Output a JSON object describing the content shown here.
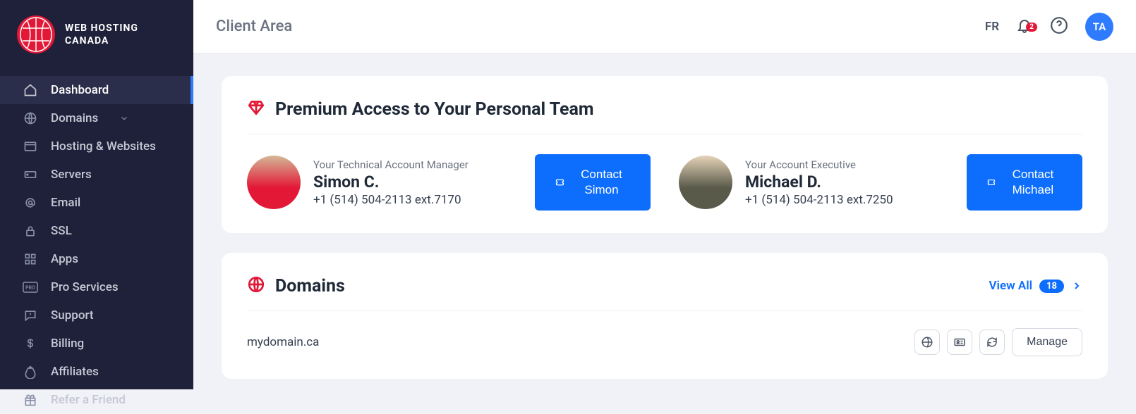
{
  "brand": {
    "line1": "WEB HOSTING",
    "line2": "CANADA"
  },
  "sidebar": {
    "items": [
      {
        "label": "Dashboard"
      },
      {
        "label": "Domains"
      },
      {
        "label": "Hosting & Websites"
      },
      {
        "label": "Servers"
      },
      {
        "label": "Email"
      },
      {
        "label": "SSL"
      },
      {
        "label": "Apps"
      },
      {
        "label": "Pro Services"
      },
      {
        "label": "Support"
      },
      {
        "label": "Billing"
      },
      {
        "label": "Affiliates"
      },
      {
        "label": "Refer a Friend"
      }
    ]
  },
  "topbar": {
    "title": "Client Area",
    "lang": "FR",
    "notification_count": "2",
    "avatar_initials": "TA"
  },
  "premium": {
    "title": "Premium Access to Your Personal Team",
    "members": [
      {
        "role": "Your Technical Account Manager",
        "name": "Simon C.",
        "phone": "+1 (514) 504-2113 ext.7170",
        "contact_label": "Contact Simon"
      },
      {
        "role": "Your Account Executive",
        "name": "Michael D.",
        "phone": "+1 (514) 504-2113 ext.7250",
        "contact_label": "Contact Michael"
      }
    ]
  },
  "domains": {
    "title": "Domains",
    "view_all": "View All",
    "count": "18",
    "items": [
      {
        "name": "mydomain.ca",
        "manage_label": "Manage"
      }
    ]
  }
}
